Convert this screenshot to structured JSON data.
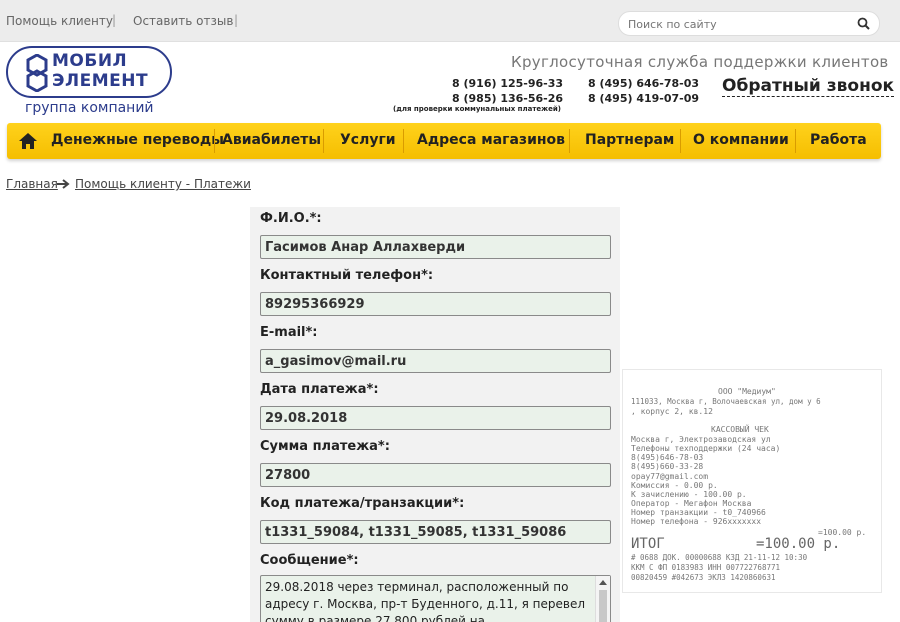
{
  "topbar": {
    "help_link": "Помощь клиенту",
    "feedback_link": "Оставить отзыв",
    "separator": "|",
    "search_placeholder": "Поиск по сайту"
  },
  "brand": {
    "line1": "МОБИЛ",
    "line2": "ЭЛЕМЕНТ",
    "subtitle": "группа компаний",
    "color": "#2c3c8c"
  },
  "header": {
    "tagline": "Круглосуточная служба поддержки клиентов",
    "phones": [
      "8 (916) 125-96-33",
      "8 (495) 646-78-03",
      "8 (985) 136-56-26",
      "8 (495) 419-07-09"
    ],
    "phone_note": "(для проверки коммунальных платежей)",
    "callback": "Обратный звонок"
  },
  "nav": {
    "items": [
      "Денежные переводы",
      "Авиабилеты",
      "Услуги",
      "Адреса магазинов",
      "Партнерам",
      "О компании",
      "Работа"
    ],
    "accent": "#ffd21c"
  },
  "breadcrumb": {
    "home": "Главная",
    "current": "Помощь клиенту - Платежи"
  },
  "form": {
    "fio_label": "Ф.И.О.*:",
    "fio_value": "Гасимов Анар Аллахверди",
    "phone_label": "Контактный телефон*:",
    "phone_value": "89295366929",
    "email_label": "E-mail*:",
    "email_value": "a_gasimov@mail.ru",
    "date_label": "Дата платежа*:",
    "date_value": "29.08.2018",
    "amount_label": "Сумма платежа*:",
    "amount_value": "27800",
    "code_label": "Код платежа/транзакции*:",
    "code_value": "t1331_59084, t1331_59085, t1331_59086",
    "message_label": "Сообщение*:",
    "message_value": "29.08.2018 через терминал, расположенный по адресу г. Москва, пр-т Буденного, д.11, я перевел сумму в размере 27 800 рублей на"
  },
  "receipt": {
    "lines": [
      "ООО \"Медиум\"",
      "111033, Москва г, Волочаевская ул, дом у 6",
      ", корпус 2, кв.12",
      "КАССОВЫЙ ЧЕК",
      "Москва г, Электрозаводская ул",
      "Телефоны техподдержки (24 часа)",
      "8(495)646-78-03",
      "8(495)660-33-28",
      "opay77@gmail.com",
      "Комиссия - 0.00 р.",
      "К зачислению - 100.00 р.",
      "Оператор - Мегафон Москва",
      "Номер транзакции - t0_740966",
      "Номер телефона - 926xxxxxxx",
      "=100.00 р.",
      "ИТОГ",
      "=100.00 р.",
      "# 0688 ДОК. 00000688 КЗД 21-11-12 10:30",
      "ККМ С ФП 0183983 ИНН 007722768771",
      "00820459 #042673 ЭКЛЗ 1420860631"
    ]
  }
}
